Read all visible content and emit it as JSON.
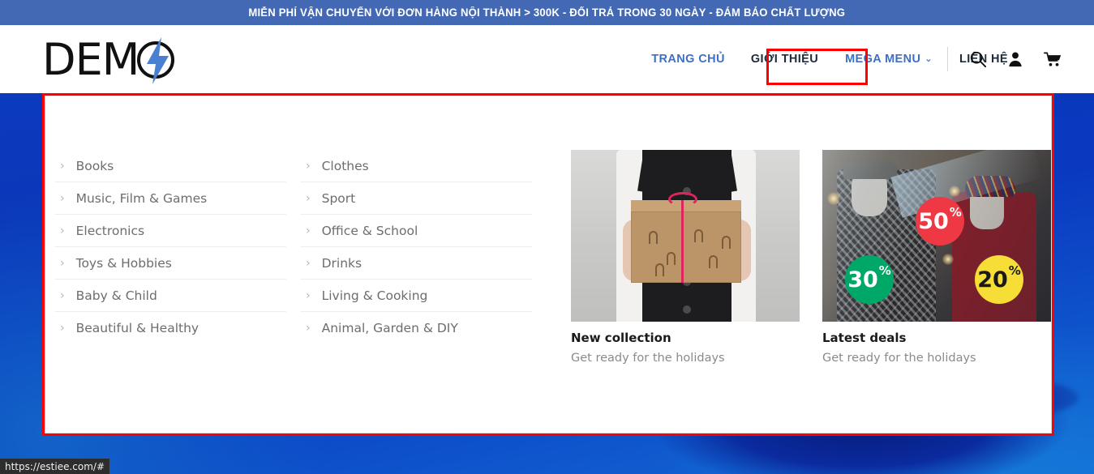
{
  "topbar": {
    "message": "MIỄN PHÍ VẬN CHUYỂN VỚI ĐƠN HÀNG NỘI THÀNH > 300K - ĐỔI TRẢ TRONG 30 NGÀY - ĐẢM BẢO CHẤT LƯỢNG",
    "bg_color": "#4469b4",
    "text_color": "#ffffff"
  },
  "header": {
    "logo": {
      "text": "DEM",
      "mark": "o-with-lightning-bolt",
      "bolt_color": "#4a7fd1"
    },
    "nav": [
      {
        "label": "TRANG CHỦ",
        "style": "accent"
      },
      {
        "label": "GIỚI THIỆU",
        "style": "plain"
      },
      {
        "label": "MEGA MENU",
        "style": "boxed-accent",
        "caret": "⌄"
      },
      {
        "label": "LIÊN HỆ",
        "style": "plain"
      }
    ],
    "icons": [
      {
        "name": "search-icon"
      },
      {
        "name": "user-icon"
      },
      {
        "name": "cart-icon"
      }
    ],
    "highlight_color": "#ff0000",
    "accent_color": "#3d6fc4"
  },
  "megamenu": {
    "columns": [
      {
        "items": [
          {
            "label": "Books"
          },
          {
            "label": "Music, Film & Games"
          },
          {
            "label": "Electronics"
          },
          {
            "label": "Toys & Hobbies"
          },
          {
            "label": "Baby & Child"
          },
          {
            "label": "Beautiful & Healthy"
          }
        ]
      },
      {
        "items": [
          {
            "label": "Clothes"
          },
          {
            "label": "Sport"
          },
          {
            "label": "Office & School"
          },
          {
            "label": "Drinks"
          },
          {
            "label": "Living & Cooking"
          },
          {
            "label": "Animal, Garden & DIY"
          }
        ]
      }
    ],
    "promos": [
      {
        "image": "gift-box-photo",
        "title": "New collection",
        "subtitle": "Get ready for the holidays"
      },
      {
        "image": "shop-window-mannequins-photo",
        "title": "Latest deals",
        "subtitle": "Get ready for the holidays",
        "badges": [
          {
            "value": "50",
            "unit": "%",
            "color": "#ee3944"
          },
          {
            "value": "30",
            "unit": "%",
            "color": "#00a868"
          },
          {
            "value": "20",
            "unit": "%",
            "color": "#f7de37"
          }
        ]
      }
    ]
  },
  "statusbar": {
    "url": "https://estiee.com/#"
  }
}
